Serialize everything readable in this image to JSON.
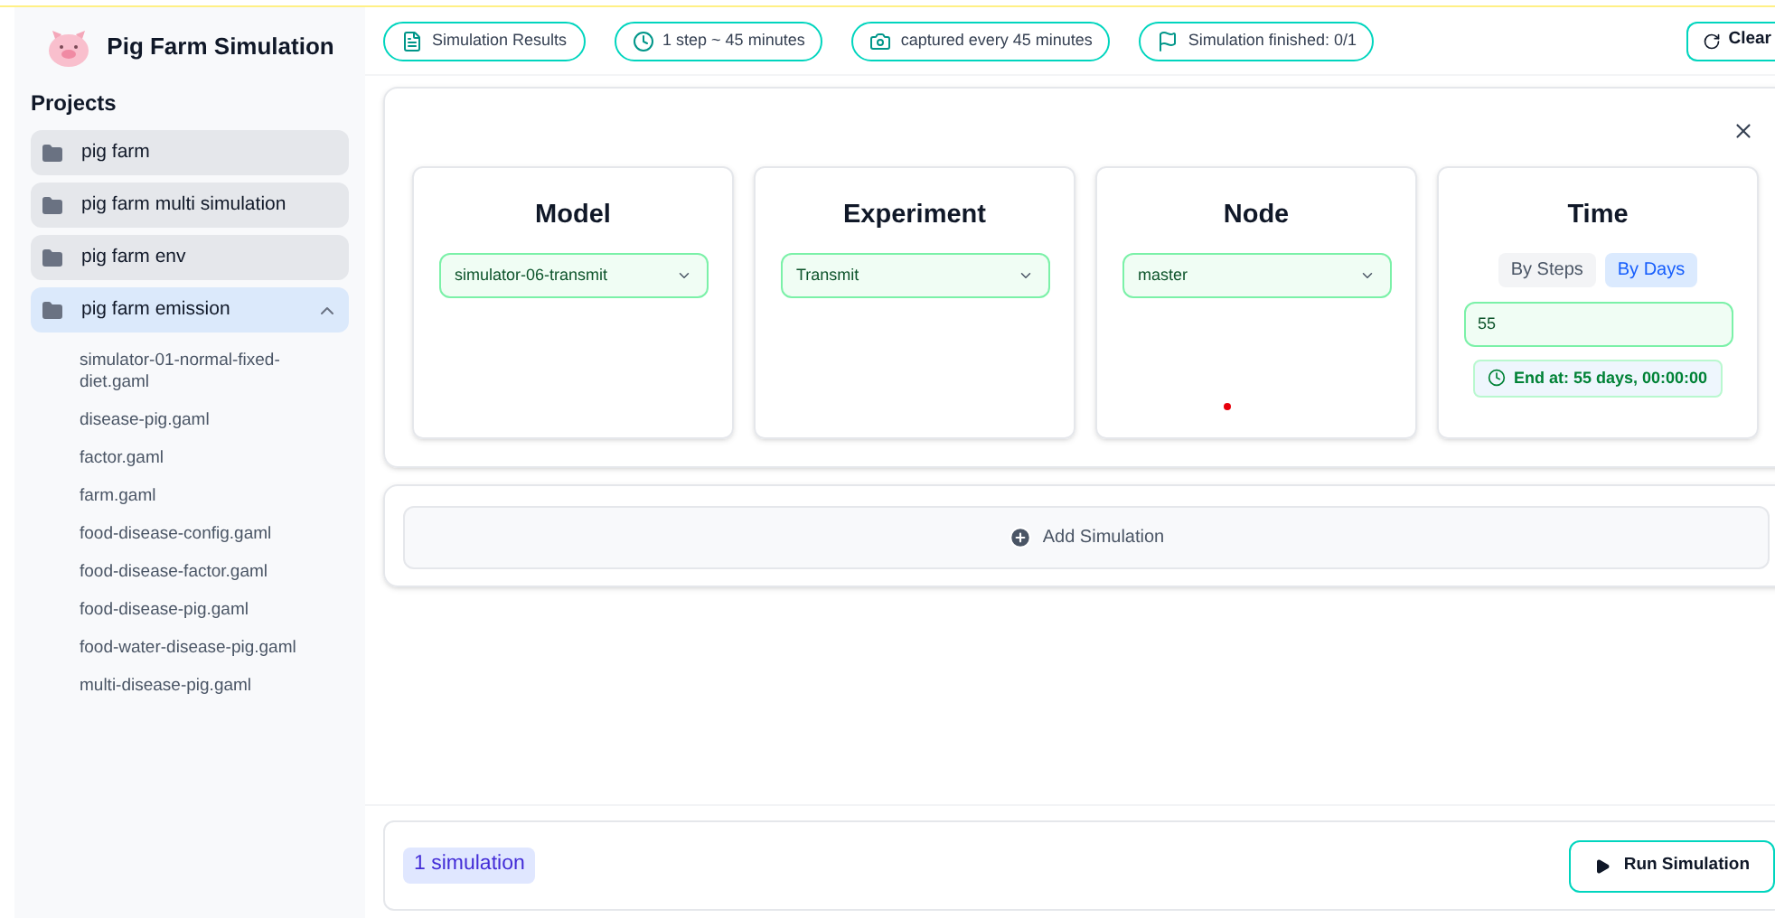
{
  "app": {
    "title": "Pig Farm Simulation"
  },
  "sidebar": {
    "heading": "Projects",
    "projects": [
      {
        "name": "pig farm",
        "expanded": false
      },
      {
        "name": "pig farm multi simulation",
        "expanded": false
      },
      {
        "name": "pig farm env",
        "expanded": false
      },
      {
        "name": "pig farm emission",
        "expanded": true,
        "children": [
          {
            "name": "simulator-01-normal-fixed-diet.gaml"
          },
          {
            "name": "disease-pig.gaml"
          },
          {
            "name": "factor.gaml"
          },
          {
            "name": "farm.gaml"
          },
          {
            "name": "food-disease-config.gaml"
          },
          {
            "name": "food-disease-factor.gaml"
          },
          {
            "name": "food-disease-pig.gaml"
          },
          {
            "name": "food-water-disease-pig.gaml"
          },
          {
            "name": "multi-disease-pig.gaml"
          }
        ]
      }
    ]
  },
  "toolbar": {
    "pills": [
      {
        "kind": "results",
        "label": "Simulation Results"
      },
      {
        "kind": "step",
        "label": "1 step ~ 45 minutes"
      },
      {
        "kind": "capture",
        "label": "captured every 45 minutes"
      },
      {
        "kind": "finished",
        "label": "Simulation finished: 0/1"
      }
    ],
    "clear_button": "Clear"
  },
  "config": {
    "cards": [
      {
        "kind": "select",
        "title": "Model",
        "value": "simulator-06-transmit"
      },
      {
        "kind": "select",
        "title": "Experiment",
        "value": "Transmit"
      },
      {
        "kind": "select",
        "title": "Node",
        "value": "master"
      },
      {
        "kind": "time",
        "title": "Time",
        "modes": [
          {
            "label": "By Steps",
            "selected": false
          },
          {
            "label": "By Days",
            "selected": true
          }
        ],
        "value": "55",
        "end_at": "End at: 55 days, 00:00:00"
      }
    ]
  },
  "add_button": "Add Simulation",
  "footer": {
    "count": "1 simulation",
    "run_button": "Run Simulation"
  }
}
